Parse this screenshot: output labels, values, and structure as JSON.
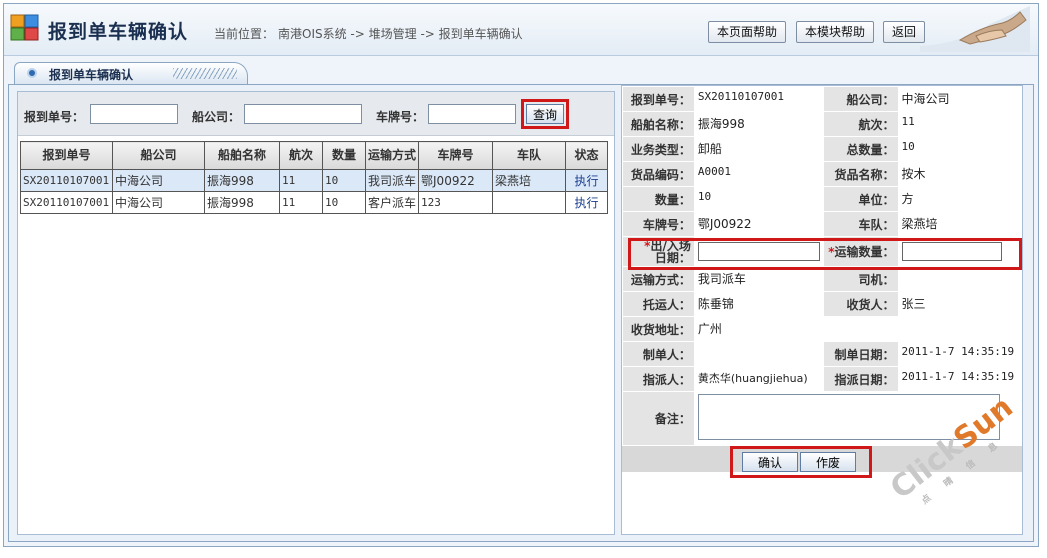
{
  "header": {
    "title": "报到单车辆确认",
    "breadcrumb": {
      "prefix": "当前位置：",
      "path": "南港OIS系统 -> 堆场管理 -> 报到单车辆确认"
    },
    "buttons": {
      "page_help": "本页面帮助",
      "module_help": "本模块帮助",
      "back": "返回"
    }
  },
  "tab": {
    "label": "报到单车辆确认"
  },
  "search": {
    "report_no_label": "报到单号：",
    "shipping_company_label": "船公司：",
    "plate_no_label": "车牌号：",
    "report_no_value": "",
    "shipping_company_value": "",
    "plate_no_value": "",
    "query_label": "查询"
  },
  "grid": {
    "headers": [
      "报到单号",
      "船公司",
      "船舶名称",
      "航次",
      "数量",
      "运输方式",
      "车牌号",
      "车队",
      "状态"
    ],
    "rows": [
      [
        "SX20110107001",
        "中海公司",
        "振海998",
        "11",
        "10",
        "我司派车",
        "鄂J00922",
        "梁燕培",
        "执行"
      ],
      [
        "SX20110107001",
        "中海公司",
        "振海998",
        "11",
        "10",
        "客户派车",
        "123",
        "",
        "执行"
      ]
    ]
  },
  "form": {
    "report_no_label": "报到单号：",
    "report_no": "SX20110107001",
    "company_label": "船公司：",
    "company": "中海公司",
    "vessel_label": "船舶名称：",
    "vessel": "振海998",
    "voyage_label": "航次：",
    "voyage": "11",
    "biz_type_label": "业务类型：",
    "biz_type": "卸船",
    "total_qty_label": "总数量：",
    "total_qty": "10",
    "goods_code_label": "货品编码：",
    "goods_code": "A0001",
    "goods_name_label": "货品名称：",
    "goods_name": "按木",
    "qty_label": "数量：",
    "qty": "10",
    "unit_label": "单位：",
    "unit": "方",
    "plate_label": "车牌号：",
    "plate": "鄂J00922",
    "fleet_label": "车队：",
    "fleet": "梁燕培",
    "inout_date_label_1": "出/入场",
    "inout_date_label_2": "日期：",
    "transport_qty_label": "运输数量：",
    "required_mark": "*",
    "inout_date": "",
    "transport_qty": "",
    "transport_mode_label": "运输方式：",
    "transport_mode": "我司派车",
    "driver_label": "司机：",
    "driver": "",
    "consignor_label": "托运人：",
    "consignor": "陈垂锦",
    "consignee_label": "收货人：",
    "consignee": "张三",
    "address_label": "收货地址：",
    "address": "广州",
    "maker_label": "制单人：",
    "maker": "",
    "make_date_label": "制单日期：",
    "make_date": "2011-1-7 14:35:19",
    "assigner_label": "指派人：",
    "assigner": "黄杰华(huangjiehua)",
    "assign_date_label": "指派日期：",
    "assign_date": "2011-1-7 14:35:19",
    "remark_label": "备注：",
    "remark": "",
    "confirm_label": "确认",
    "void_label": "作废"
  },
  "watermark": {
    "brand_a": "Click",
    "brand_b": "Sun",
    "sub": "点 晴 信 息"
  },
  "colors": {
    "accent": "#1b3050",
    "highlight": "#d01818",
    "selected_row": "#dbe8f7"
  }
}
